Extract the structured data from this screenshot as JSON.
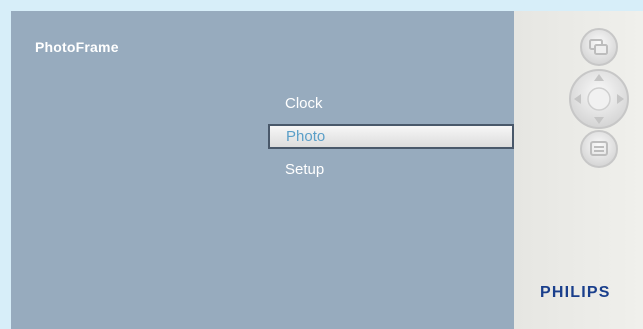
{
  "header": {
    "title": "PhotoFrame"
  },
  "menu": {
    "items": [
      {
        "label": "Clock",
        "selected": false
      },
      {
        "label": "Photo",
        "selected": true
      },
      {
        "label": "Setup",
        "selected": false
      }
    ]
  },
  "side_panel": {
    "brand": "PHILIPS",
    "buttons": [
      {
        "icon": "slideshow-icon"
      },
      {
        "icon": "navigation-pad-icon"
      },
      {
        "icon": "menu-icon"
      }
    ]
  },
  "colors": {
    "background": "#d7eef9",
    "screen": "#97abbe",
    "menu_text": "#ffffff",
    "selected_text": "#5b9fc8",
    "selected_border": "#49586a",
    "brand": "#1a3f8c"
  }
}
